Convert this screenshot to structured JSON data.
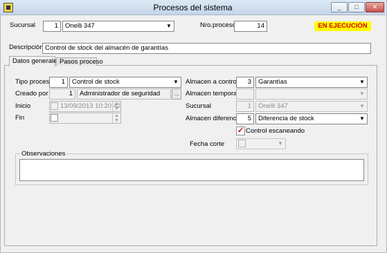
{
  "window": {
    "title": "Procesos del sistema",
    "minimize": "_",
    "maximize": "□",
    "close": "✕"
  },
  "header": {
    "sucursal_label": "Sucursal",
    "sucursal_code": "1",
    "sucursal_name": "Onelli 347",
    "nro_proceso_label": "Nro.proceso",
    "nro_proceso_value": "14",
    "status": "EN EJECUCIÓN",
    "status_color": "#d40000",
    "status_bg": "#ffff00"
  },
  "descripcion": {
    "label": "Descripción",
    "value": "Control de stock del almacén de garantías"
  },
  "tabs": [
    {
      "label": "Datos generales",
      "active": true
    },
    {
      "label": "Pasos proceso",
      "active": false
    }
  ],
  "form": {
    "tipo_proceso_label": "Tipo proceso",
    "tipo_proceso_code": "1",
    "tipo_proceso_value": "Control de stock",
    "creado_por_label": "Creado por",
    "creado_por_code": "1",
    "creado_por_value": "Administrador de seguridad",
    "creado_por_btn": "...",
    "inicio_label": "Inicio",
    "inicio_value": "13/09/2013 10:20:42",
    "fin_label": "Fin",
    "fin_value": "",
    "almacen_controlar_label": "Almacen a controlar",
    "almacen_controlar_code": "3",
    "almacen_controlar_value": "Garantías",
    "almacen_temporario_label": "Almacen temporario",
    "almacen_temporario_code": "",
    "almacen_temporario_value": "",
    "sucursal_label": "Sucursal",
    "sucursal_code": "1",
    "sucursal_value": "Onelli 347",
    "almacen_diferencias_label": "Almacen diferencias",
    "almacen_diferencias_code": "5",
    "almacen_diferencias_value": "Diferencia de stock",
    "control_escaneando_label": "Control escaneando",
    "control_escaneando_checked": true,
    "fecha_corte_label": "Fecha corte",
    "fecha_corte_value": "",
    "observaciones_label": "Observaciones",
    "observaciones_value": ""
  },
  "icons": {
    "dropdown": "chevron-down-icon",
    "app": "app-icon"
  }
}
